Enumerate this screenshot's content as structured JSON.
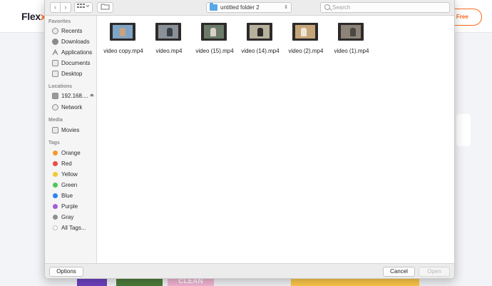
{
  "background_page": {
    "logo_left": "Flex",
    "cta_label": "- Free",
    "thumbnail_text": "CLEAN"
  },
  "toolbar": {
    "back_icon": "chevron-left-icon",
    "forward_icon": "chevron-right-icon",
    "view_icon": "grid-view-icon",
    "current_folder": "untitled folder 2",
    "search_placeholder": "Search"
  },
  "sidebar": {
    "sections": [
      {
        "title": "Favorites",
        "items": [
          "Recents",
          "Downloads",
          "Applications",
          "Documents",
          "Desktop"
        ]
      },
      {
        "title": "Locations",
        "items": [
          "192.168....",
          "Network"
        ]
      },
      {
        "title": "Media",
        "items": [
          "Movies"
        ]
      },
      {
        "title": "Tags",
        "items": [
          "Orange",
          "Red",
          "Yellow",
          "Green",
          "Blue",
          "Purple",
          "Gray",
          "All Tags..."
        ]
      }
    ],
    "tag_colors": {
      "Orange": "#f39a2b",
      "Red": "#ea4c47",
      "Yellow": "#f3c92f",
      "Green": "#4ec756",
      "Blue": "#2f83f0",
      "Purple": "#a55fcf",
      "Gray": "#8e8e92"
    }
  },
  "files": [
    {
      "name": "video copy.mp4"
    },
    {
      "name": "video.mp4"
    },
    {
      "name": "video (15).mp4"
    },
    {
      "name": "video (14).mp4"
    },
    {
      "name": "video (2).mp4"
    },
    {
      "name": "video (1).mp4"
    }
  ],
  "footer": {
    "options_label": "Options",
    "cancel_label": "Cancel",
    "open_label": "Open"
  }
}
